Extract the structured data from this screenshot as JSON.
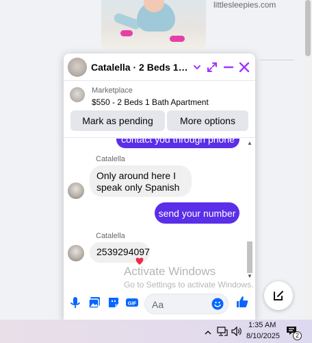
{
  "background": {
    "post_domain": "littlesleepies.com"
  },
  "chat": {
    "title": "Catalella · 2 Beds 1 Bathroom Apartment",
    "listing": {
      "source": "Marketplace",
      "price_title": "$550 - 2 Beds 1 Bath Apartment",
      "mark_pending_label": "Mark as pending",
      "more_options_label": "More options"
    },
    "messages": [
      {
        "direction": "outgoing",
        "text": "contact you through phone"
      },
      {
        "direction": "incoming",
        "sender": "Catalella",
        "text_line1": "Only around here I",
        "text_line2": "speak only Spanish"
      },
      {
        "direction": "outgoing",
        "text": "send your number"
      },
      {
        "direction": "incoming",
        "sender": "Catalella",
        "text": "2539294097",
        "reaction": "heart-reaction"
      }
    ],
    "composer": {
      "placeholder": "Aa"
    },
    "accent_color": "#a033ff",
    "bubble_color": "#5b2ee8"
  },
  "watermark": {
    "line1": "Activate Windows",
    "line2": "Go to Settings to activate Windows."
  },
  "taskbar": {
    "time": "1:35 AM",
    "date": "8/10/2025",
    "notification_count": "2"
  }
}
